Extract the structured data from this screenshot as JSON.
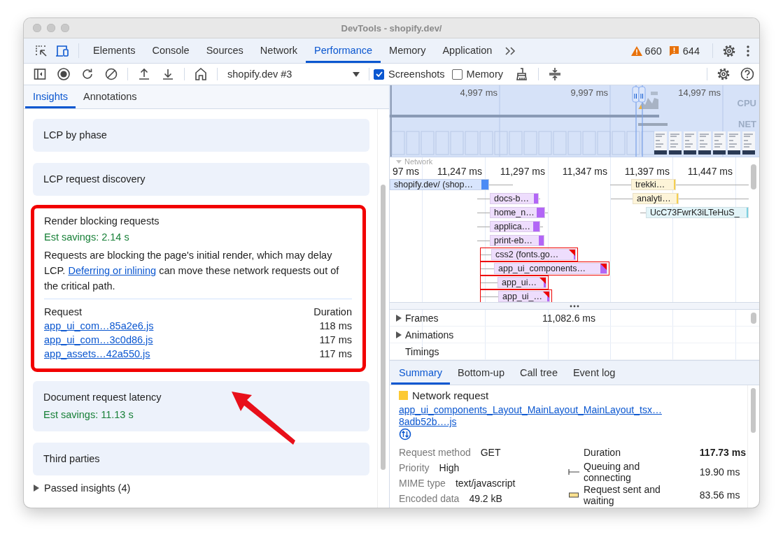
{
  "window": {
    "title": "DevTools - shopify.dev/"
  },
  "panel_tabs": [
    {
      "label": "Elements",
      "selected": false
    },
    {
      "label": "Console",
      "selected": false
    },
    {
      "label": "Sources",
      "selected": false
    },
    {
      "label": "Network",
      "selected": false
    },
    {
      "label": "Performance",
      "selected": true
    },
    {
      "label": "Memory",
      "selected": false
    },
    {
      "label": "Application",
      "selected": false
    }
  ],
  "counts": [
    {
      "kind": "warning",
      "value": "660"
    },
    {
      "kind": "issue",
      "value": "644"
    }
  ],
  "toolbar": {
    "recording": "shopify.dev #3",
    "options": [
      {
        "label": "Screenshots",
        "checked": true
      },
      {
        "label": "Memory",
        "checked": false
      }
    ]
  },
  "sidebar": {
    "tabs": [
      {
        "label": "Insights",
        "selected": true
      },
      {
        "label": "Annotations",
        "selected": false
      }
    ],
    "insights": [
      {
        "title": "LCP by phase",
        "expanded": false
      },
      {
        "title": "LCP request discovery",
        "expanded": false
      },
      {
        "title": "Render blocking requests",
        "expanded": true,
        "highlighted": true,
        "savings": "Est savings: 2.14 s",
        "description": "Requests are blocking the page's initial render, which may delay LCP. ",
        "link": "Deferring or inlining",
        "description_end": " can move these network requests out of the critical path.",
        "columns": [
          "Request",
          "Duration"
        ],
        "rows": [
          {
            "request": "app_ui_com…85a2e6.js",
            "duration": "118 ms"
          },
          {
            "request": "app_ui_com…3c0d86.js",
            "duration": "117 ms"
          },
          {
            "request": "app_assets…42a550.js",
            "duration": "117 ms"
          }
        ]
      },
      {
        "title": "Document request latency",
        "expanded": false,
        "savings": "Est savings: 11.13 s"
      },
      {
        "title": "Third parties",
        "expanded": false
      }
    ],
    "passed": "Passed insights (4)"
  },
  "overview": {
    "ticks": [
      "4,997 ms",
      "9,997 ms",
      "14,997 ms"
    ],
    "tracks": [
      "CPU",
      "NET"
    ]
  },
  "network": {
    "label": "Network",
    "ticks": [
      "97 ms",
      "11,247 ms",
      "11,297 ms",
      "11,347 ms",
      "11,397 ms",
      "11,447 ms"
    ],
    "requests": [
      {
        "label": "shopify.dev/ (shop…",
        "color": "#4c8bf5",
        "render_blocking": false
      },
      {
        "label": "trekki…",
        "color": "#f5cf4f",
        "render_blocking": false
      },
      {
        "label": "docs-b…",
        "color": "#b266f6",
        "render_blocking": false
      },
      {
        "label": "analyti…",
        "color": "#f5cf4f",
        "render_blocking": false
      },
      {
        "label": "home_n…",
        "color": "#b266f6",
        "render_blocking": false
      },
      {
        "label": "UcC73FwrK3iLTeHuS_",
        "color": "#7ccfe0",
        "render_blocking": false
      },
      {
        "label": "applica…",
        "color": "#b266f6",
        "render_blocking": false
      },
      {
        "label": "print-eb…",
        "color": "#b266f6",
        "render_blocking": false
      },
      {
        "label": "css2 (fonts.go…",
        "color": "#b266f6",
        "render_blocking": true
      },
      {
        "label": "app_ui_components…",
        "color": "#b266f6",
        "render_blocking": true
      },
      {
        "label": "app_ui…",
        "color": "#b266f6",
        "render_blocking": true
      },
      {
        "label": "app_ui_…",
        "color": "#b266f6",
        "render_blocking": true
      }
    ]
  },
  "tracks": [
    {
      "label": "Frames",
      "expandable": true,
      "value": "11,082.6 ms"
    },
    {
      "label": "Animations",
      "expandable": true
    },
    {
      "label": "Timings",
      "expandable": false
    }
  ],
  "details": {
    "tabs": [
      {
        "label": "Summary",
        "selected": true
      },
      {
        "label": "Bottom-up",
        "selected": false
      },
      {
        "label": "Call tree",
        "selected": false
      },
      {
        "label": "Event log",
        "selected": false
      }
    ],
    "title": "Network request",
    "url_lines": [
      "app_ui_components_Layout_MainLayout_MainLayout_tsx…",
      "8adb52b….js"
    ],
    "fields": [
      {
        "label": "Request method",
        "value": "GET"
      },
      {
        "label": "Priority",
        "value": "High"
      },
      {
        "label": "MIME type",
        "value": "text/javascript"
      },
      {
        "label": "Encoded data",
        "value": "49.2 kB"
      }
    ],
    "timing": [
      {
        "kind": "total",
        "label": "Duration",
        "value": "117.73 ms"
      },
      {
        "kind": "queue",
        "label": "Queuing and connecting",
        "value": "19.90 ms"
      },
      {
        "kind": "waiting",
        "label": "Request sent and waiting",
        "value": "83.56 ms"
      }
    ]
  }
}
